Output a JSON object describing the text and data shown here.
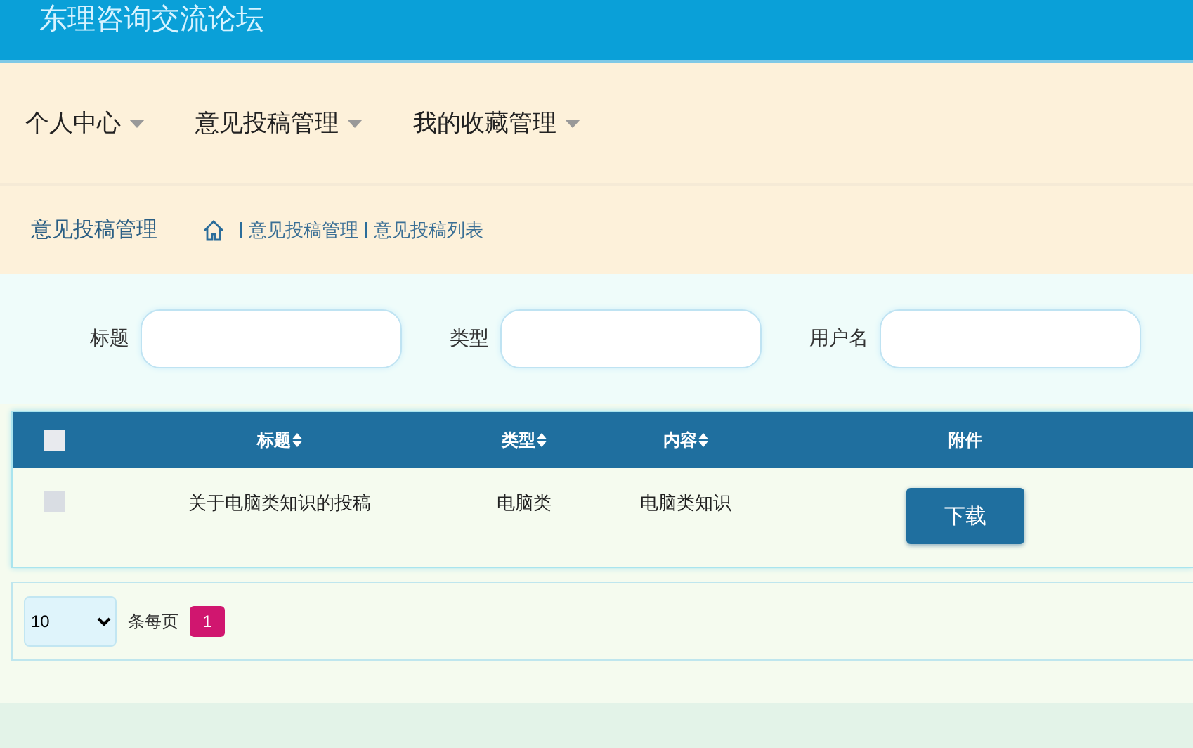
{
  "site_title": "东理咨询交流论坛",
  "nav": [
    {
      "label": "个人中心"
    },
    {
      "label": "意见投稿管理"
    },
    {
      "label": "我的收藏管理"
    }
  ],
  "section_title": "意见投稿管理",
  "breadcrumb": [
    "意见投稿管理",
    "意见投稿列表"
  ],
  "filters": [
    {
      "label": "标题"
    },
    {
      "label": "类型"
    },
    {
      "label": "用户名"
    }
  ],
  "table": {
    "select_all_checked": false,
    "columns": [
      {
        "label": "标题",
        "sortable": true
      },
      {
        "label": "类型",
        "sortable": true
      },
      {
        "label": "内容",
        "sortable": true
      },
      {
        "label": "附件",
        "sortable": false
      }
    ],
    "rows": [
      {
        "checked": false,
        "cells": [
          "关于电脑类知识的投稿",
          "电脑类",
          "电脑类知识"
        ],
        "action": "下载"
      }
    ]
  },
  "pagination": {
    "page_size": "10",
    "page_size_label": "条每页",
    "pages": [
      {
        "label": "1",
        "selected": true
      }
    ]
  }
}
